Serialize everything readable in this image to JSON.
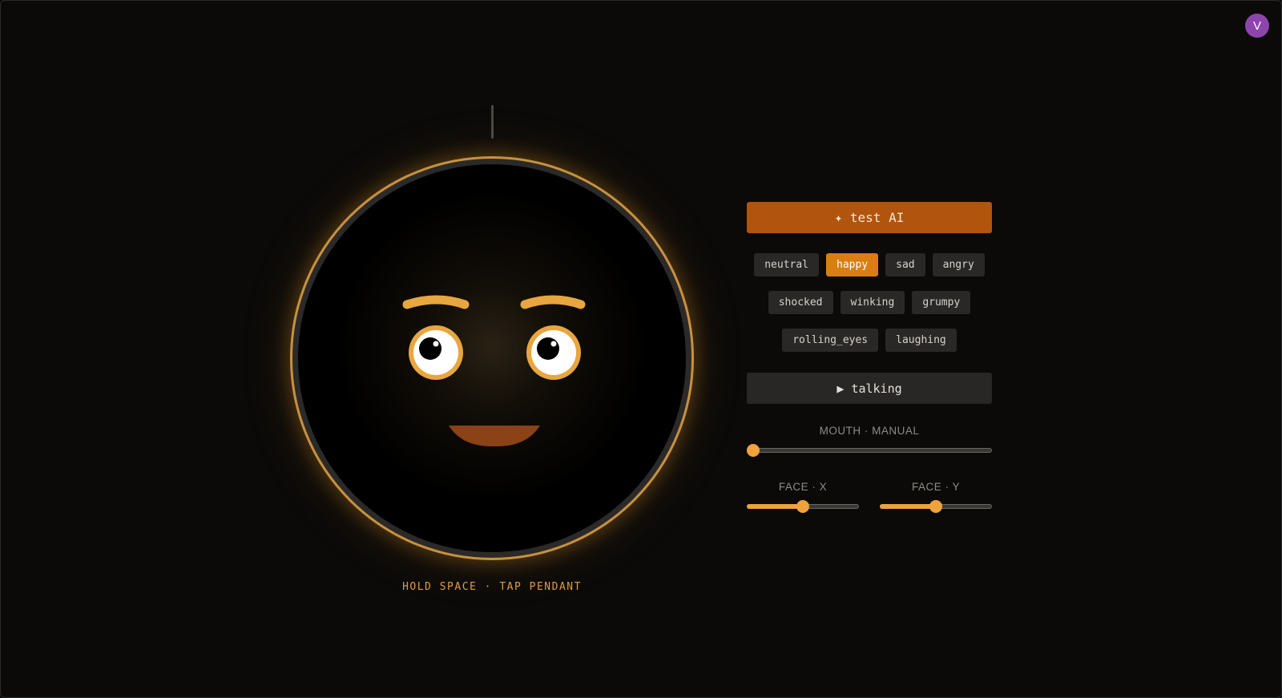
{
  "user": {
    "avatar_initial": "V",
    "avatar_color": "#8e44ad"
  },
  "pendant": {
    "hint": "HOLD SPACE · TAP PENDANT",
    "ring_color": "#c8913e",
    "feature_color": "#e8a640",
    "mouth_color": "#8a4216",
    "expression": "happy"
  },
  "controls": {
    "ai_button_label": "✦ test AI",
    "expressions": [
      {
        "label": "neutral",
        "active": false
      },
      {
        "label": "happy",
        "active": true
      },
      {
        "label": "sad",
        "active": false
      },
      {
        "label": "angry",
        "active": false
      },
      {
        "label": "shocked",
        "active": false
      },
      {
        "label": "winking",
        "active": false
      },
      {
        "label": "grumpy",
        "active": false
      },
      {
        "label": "rolling_eyes",
        "active": false
      },
      {
        "label": "laughing",
        "active": false
      }
    ],
    "talking_button_label": "▶ talking",
    "mouth_slider": {
      "label": "MOUTH · MANUAL",
      "value": 0.0
    },
    "face_x_slider": {
      "label": "FACE · X",
      "value": 0.5
    },
    "face_y_slider": {
      "label": "FACE · Y",
      "value": 0.5
    }
  },
  "colors": {
    "accent": "#f0a23c",
    "ai_button": "#b0540e",
    "active_chip": "#d97e12",
    "background": "#0b0a09"
  }
}
